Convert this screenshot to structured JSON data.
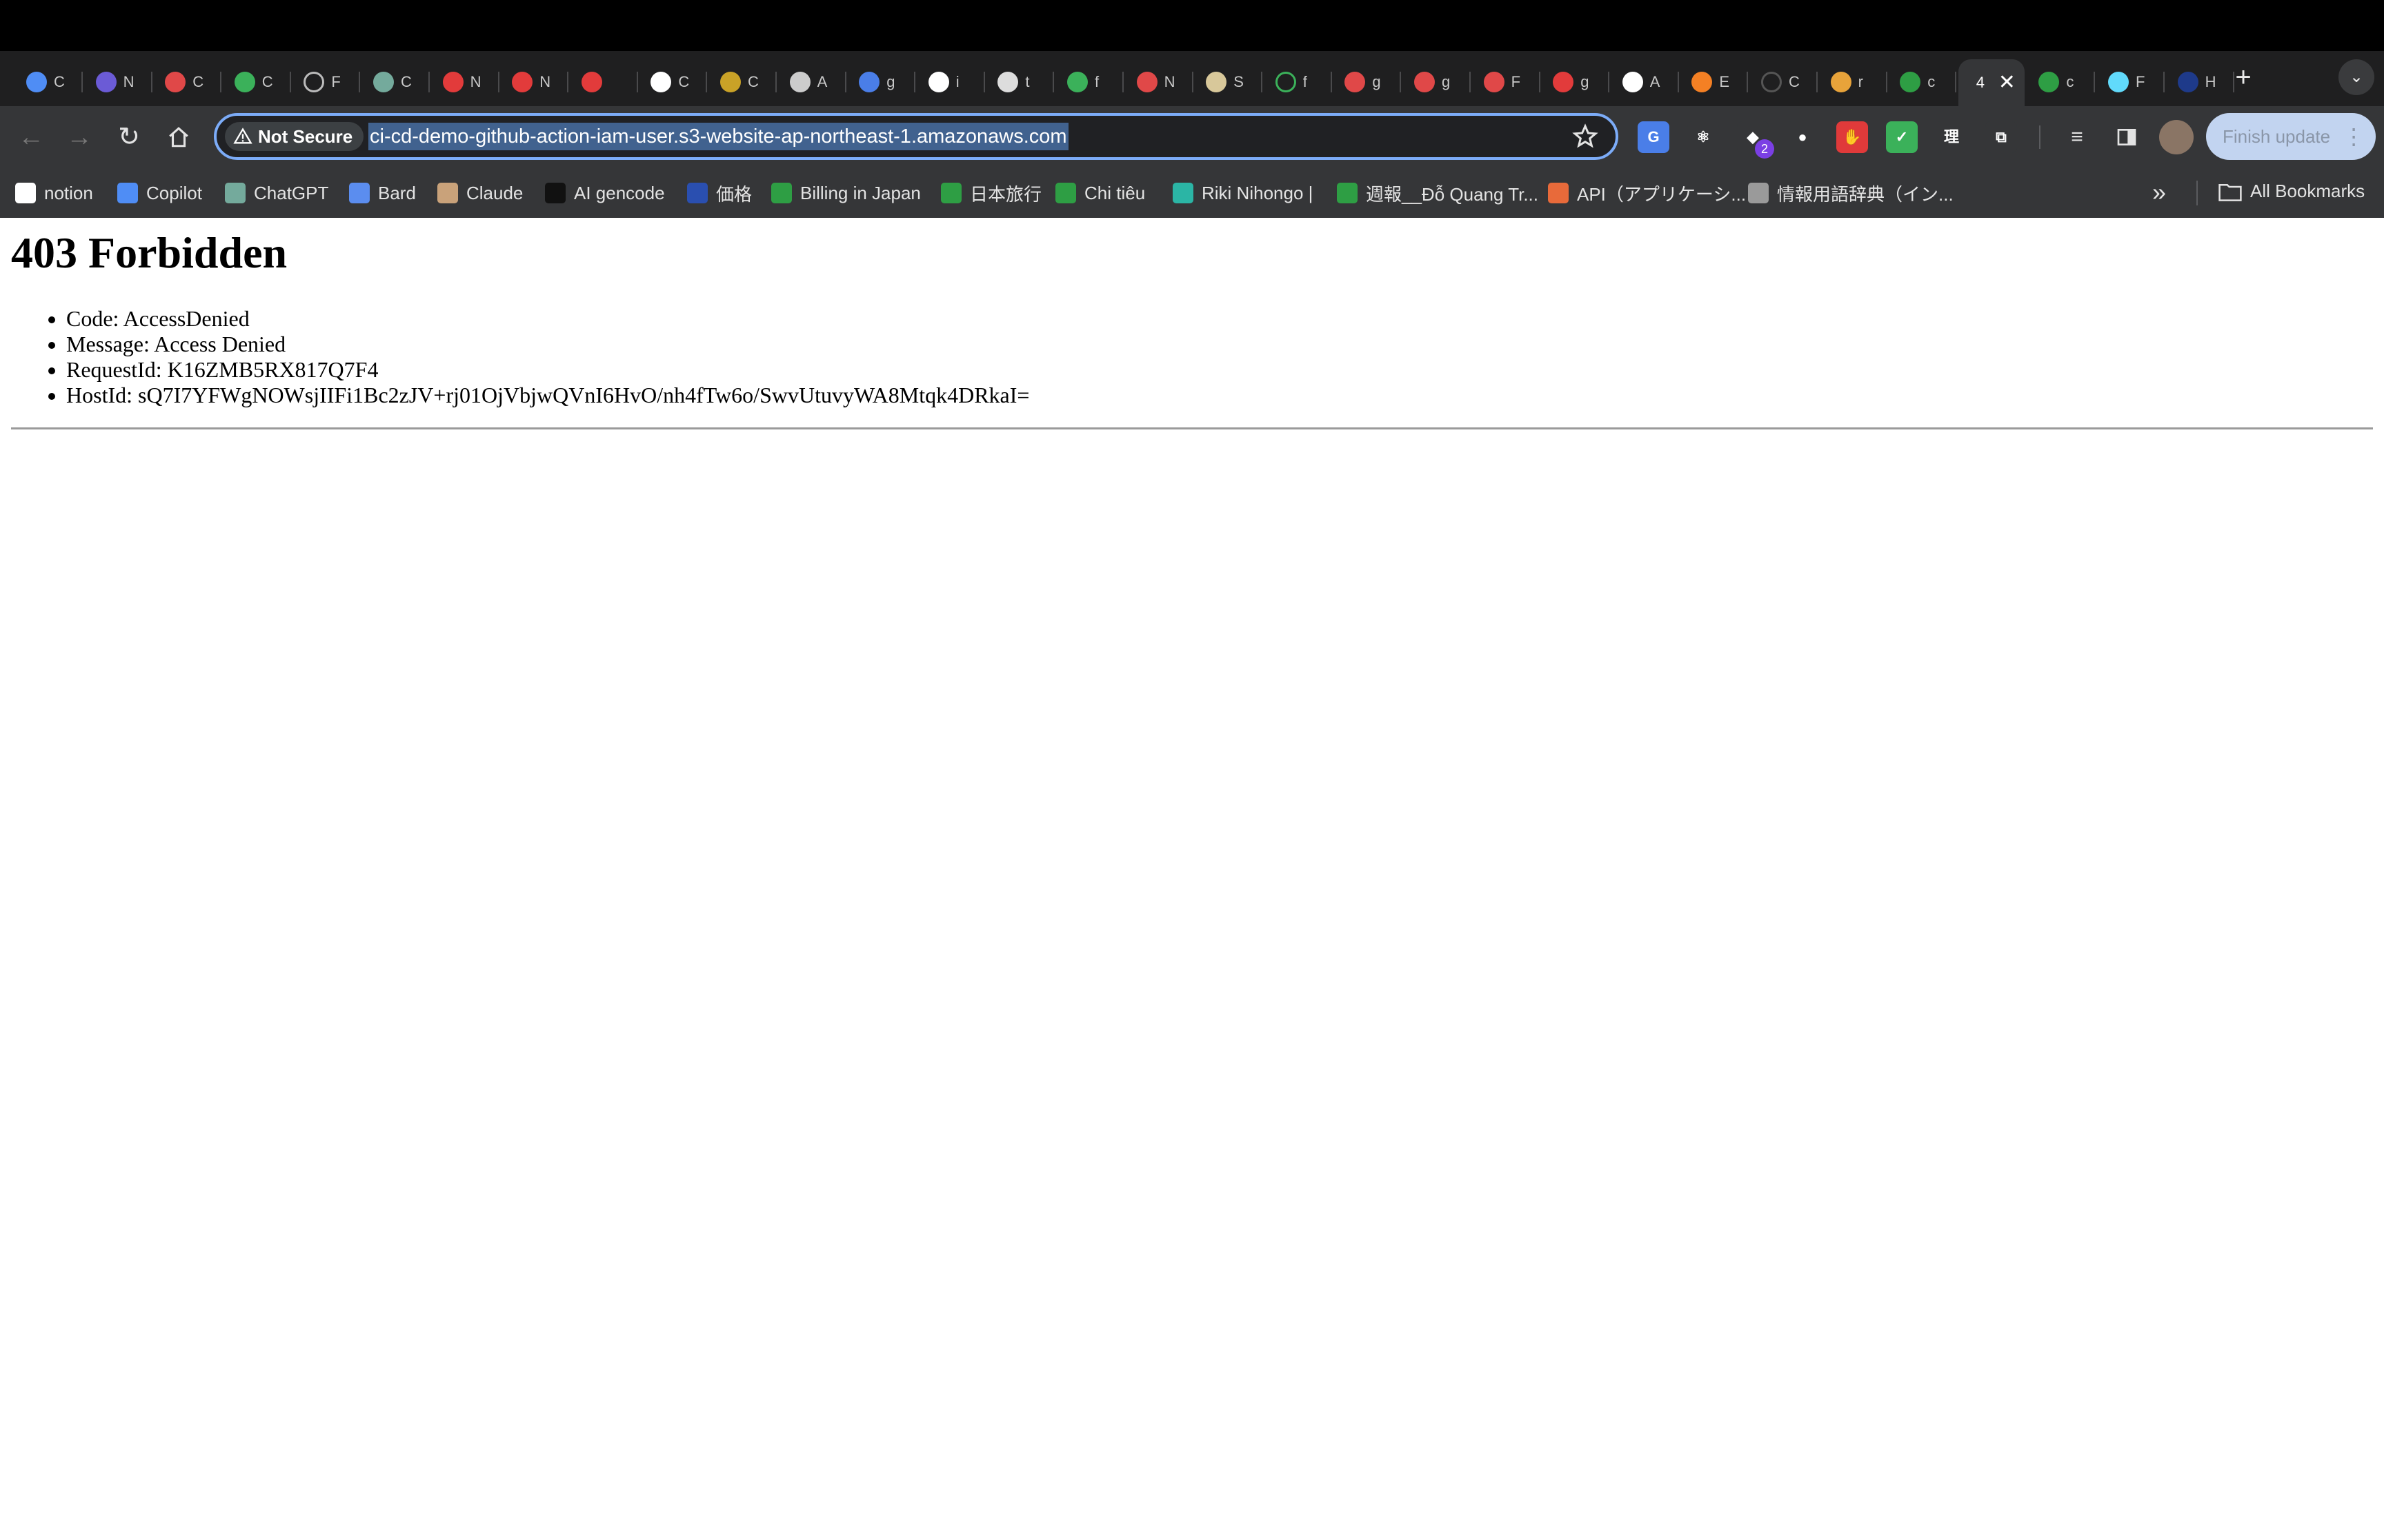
{
  "tabs": [
    {
      "icon": "copilot-icon",
      "title": "C",
      "color": "#4f8df5"
    },
    {
      "icon": "app-icon",
      "title": "N",
      "color": "#6b5bd6"
    },
    {
      "icon": "notebook-icon",
      "title": "C",
      "color": "#e04848"
    },
    {
      "icon": "chatgpt-icon",
      "title": "C",
      "color": "#3bb15a"
    },
    {
      "icon": "loading-icon",
      "title": "F",
      "color": "#bbbbbb"
    },
    {
      "icon": "chatgpt-icon",
      "title": "C",
      "color": "#74aa9c"
    },
    {
      "icon": "record-icon",
      "title": "N",
      "color": "#e23b3b"
    },
    {
      "icon": "record-icon",
      "title": "N",
      "color": "#e23b3b"
    },
    {
      "icon": "record-icon",
      "title": "",
      "color": "#e23b3b"
    },
    {
      "icon": "github-icon",
      "title": "C",
      "color": "#ffffff"
    },
    {
      "icon": "app-icon",
      "title": "C",
      "color": "#c9a227"
    },
    {
      "icon": "github-icon",
      "title": "A",
      "color": "#cccccc"
    },
    {
      "icon": "app-icon",
      "title": "g",
      "color": "#4a7ee8"
    },
    {
      "icon": "google-icon",
      "title": "i",
      "color": "#ffffff"
    },
    {
      "icon": "chatgpt-icon",
      "title": "t",
      "color": "#dddddd"
    },
    {
      "icon": "chatgpt-icon",
      "title": "f",
      "color": "#3bb15a"
    },
    {
      "icon": "kana-icon",
      "title": "N",
      "color": "#e04848"
    },
    {
      "icon": "flower-icon",
      "title": "S",
      "color": "#d8c89a"
    },
    {
      "icon": "loading-icon",
      "title": "f",
      "color": "#3bb15a"
    },
    {
      "icon": "calendar-icon",
      "title": "g",
      "color": "#e04848"
    },
    {
      "icon": "calendar-icon",
      "title": "g",
      "color": "#e04848"
    },
    {
      "icon": "calendar-icon",
      "title": "F",
      "color": "#e04848"
    },
    {
      "icon": "record-icon",
      "title": "g",
      "color": "#e23b3b"
    },
    {
      "icon": "github-icon",
      "title": "A",
      "color": "#ffffff"
    },
    {
      "icon": "stackoverflow-icon",
      "title": "E",
      "color": "#f48024"
    },
    {
      "icon": "loading-icon",
      "title": "C",
      "color": "#555555"
    },
    {
      "icon": "app-icon",
      "title": "r",
      "color": "#e8a33a"
    },
    {
      "icon": "sheet-icon",
      "title": "c",
      "color": "#2e9e44"
    },
    {
      "icon": "active-tab-icon",
      "title": "4",
      "color": "#ffffff"
    },
    {
      "icon": "sheet-icon",
      "title": "c",
      "color": "#2e9e44"
    },
    {
      "icon": "react-icon",
      "title": "F",
      "color": "#61dafb"
    },
    {
      "icon": "app-icon",
      "title": "H",
      "color": "#1e3a8a"
    }
  ],
  "omnibox": {
    "security_label": "Not Secure",
    "url": "ci-cd-demo-github-action-iam-user.s3-website-ap-northeast-1.amazonaws.com"
  },
  "extensions": [
    {
      "icon": "translate-icon",
      "label": "G",
      "color": "#4a7ee8"
    },
    {
      "icon": "react-devtools-icon",
      "label": "⚛",
      "color": "#353638"
    },
    {
      "icon": "extension-badge-icon",
      "label": "◆",
      "color": "#353638",
      "badge": "2"
    },
    {
      "icon": "fire-icon",
      "label": "●",
      "color": "#353638"
    },
    {
      "icon": "hand-icon",
      "label": "✋",
      "color": "#e03a3a"
    },
    {
      "icon": "shield-icon",
      "label": "✓",
      "color": "#3bb15a"
    },
    {
      "icon": "kanji-icon",
      "label": "理",
      "color": "#353638"
    },
    {
      "icon": "puzzle-icon",
      "label": "⧉",
      "color": "#353638"
    }
  ],
  "toolbar": {
    "finish_update_label": "Finish update"
  },
  "bookmarks": [
    {
      "icon": "notion-icon",
      "label": "notion",
      "color": "#ffffff"
    },
    {
      "icon": "copilot-icon",
      "label": "Copilot",
      "color": "#4f8df5"
    },
    {
      "icon": "chatgpt-icon",
      "label": "ChatGPT",
      "color": "#74aa9c"
    },
    {
      "icon": "bard-icon",
      "label": "Bard",
      "color": "#5b8def"
    },
    {
      "icon": "claude-icon",
      "label": "Claude",
      "color": "#c9a27a"
    },
    {
      "icon": "ai-gencode-icon",
      "label": "AI gencode",
      "color": "#111111"
    },
    {
      "icon": "price-icon",
      "label": "価格",
      "color": "#2a4fb0"
    },
    {
      "icon": "sheets-icon",
      "label": "Billing in Japan",
      "color": "#2e9e44"
    },
    {
      "icon": "sheets-icon",
      "label": "日本旅行",
      "color": "#2e9e44"
    },
    {
      "icon": "sheets-icon",
      "label": "Chi tiêu",
      "color": "#2e9e44"
    },
    {
      "icon": "riki-icon",
      "label": "Riki Nihongo |",
      "color": "#2bb5a5"
    },
    {
      "icon": "sheets-icon",
      "label": "週報__Đỗ Quang Tr...",
      "color": "#2e9e44"
    },
    {
      "icon": "api-icon",
      "label": "API（アプリケーシ...",
      "color": "#e86a3a"
    },
    {
      "icon": "globe-icon",
      "label": "情報用語辞典（イン...",
      "color": "#9a9a9a"
    }
  ],
  "all_bookmarks_label": "All Bookmarks",
  "page": {
    "heading": "403 Forbidden",
    "items": [
      "Code: AccessDenied",
      "Message: Access Denied",
      "RequestId: K16ZMB5RX817Q7F4",
      "HostId: sQ7I7YFWgNOWsjIIFi1Bc2zJV+rj01OjVbjwQVnI6HvO/nh4fTw6o/SwvUtuvyWA8Mtqk4DRkaI="
    ]
  }
}
